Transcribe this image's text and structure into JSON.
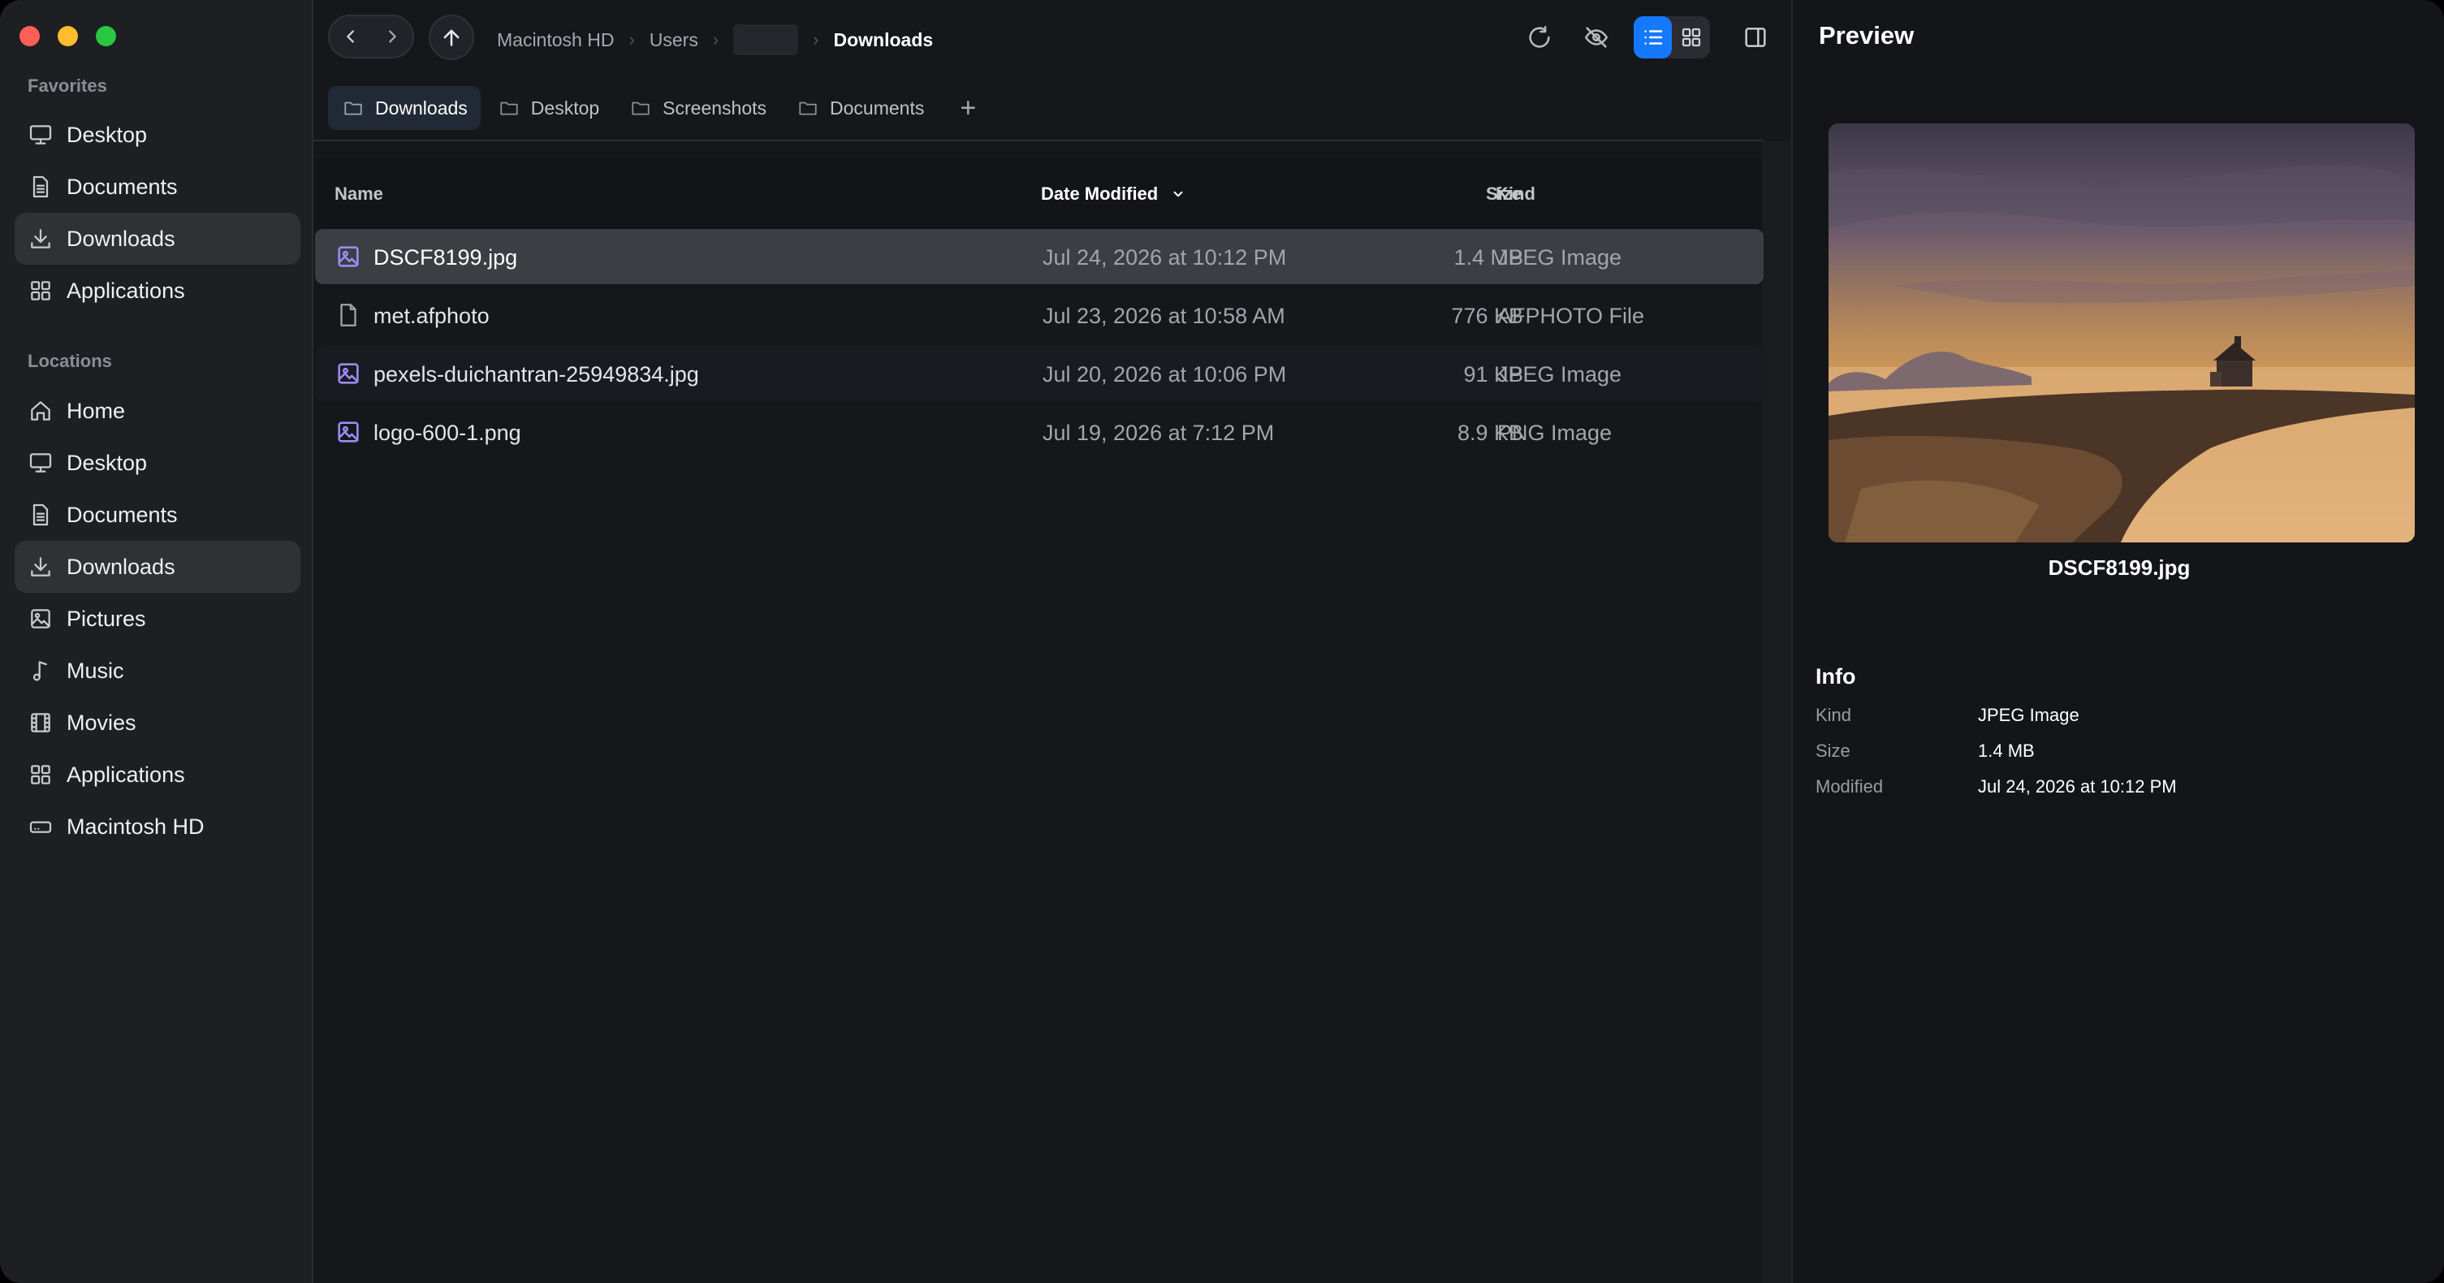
{
  "sidebar": {
    "favorites_label": "Favorites",
    "favorites": [
      {
        "label": "Desktop",
        "icon": "desktop-icon"
      },
      {
        "label": "Documents",
        "icon": "document-icon"
      },
      {
        "label": "Downloads",
        "icon": "download-icon",
        "active": true
      },
      {
        "label": "Applications",
        "icon": "apps-grid-icon"
      }
    ],
    "locations_label": "Locations",
    "locations": [
      {
        "label": "Home",
        "icon": "home-icon"
      },
      {
        "label": "Desktop",
        "icon": "desktop-icon"
      },
      {
        "label": "Documents",
        "icon": "document-icon"
      },
      {
        "label": "Downloads",
        "icon": "download-icon",
        "active": true
      },
      {
        "label": "Pictures",
        "icon": "picture-icon"
      },
      {
        "label": "Music",
        "icon": "music-note-icon"
      },
      {
        "label": "Movies",
        "icon": "film-icon"
      },
      {
        "label": "Applications",
        "icon": "apps-grid-icon"
      },
      {
        "label": "Macintosh HD",
        "icon": "drive-icon"
      }
    ]
  },
  "breadcrumb": {
    "items": [
      "Macintosh HD",
      "Users",
      "",
      "Downloads"
    ]
  },
  "tabs": [
    {
      "label": "Downloads",
      "active": true
    },
    {
      "label": "Desktop"
    },
    {
      "label": "Screenshots"
    },
    {
      "label": "Documents"
    }
  ],
  "columns": {
    "name": "Name",
    "date": "Date Modified",
    "size": "Size",
    "kind": "Kind"
  },
  "files": [
    {
      "name": "DSCF8199.jpg",
      "date": "Jul 24, 2026 at 10:12 PM",
      "size": "1.4 MB",
      "kind": "JPEG Image",
      "icon": "image-file-icon",
      "selected": true
    },
    {
      "name": "met.afphoto",
      "date": "Jul 23, 2026 at 10:58 AM",
      "size": "776 KB",
      "kind": "AFPHOTO File",
      "icon": "generic-file-icon"
    },
    {
      "name": "pexels-duichantran-25949834.jpg",
      "date": "Jul 20, 2026 at 10:06 PM",
      "size": "91 KB",
      "kind": "JPEG Image",
      "icon": "image-file-icon"
    },
    {
      "name": "logo-600-1.png",
      "date": "Jul 19, 2026 at 7:12 PM",
      "size": "8.9 KB",
      "kind": "PNG Image",
      "icon": "image-file-icon"
    }
  ],
  "preview": {
    "title": "Preview",
    "file_name": "DSCF8199.jpg",
    "info_title": "Info",
    "info": [
      {
        "key": "Kind",
        "value": "JPEG Image"
      },
      {
        "key": "Size",
        "value": "1.4 MB"
      },
      {
        "key": "Modified",
        "value": "Jul 24, 2026 at 10:12 PM"
      }
    ]
  },
  "colors": {
    "accent": "#1479ff",
    "image_icon": "#9b8cf5",
    "selection": "#3c3e43"
  }
}
